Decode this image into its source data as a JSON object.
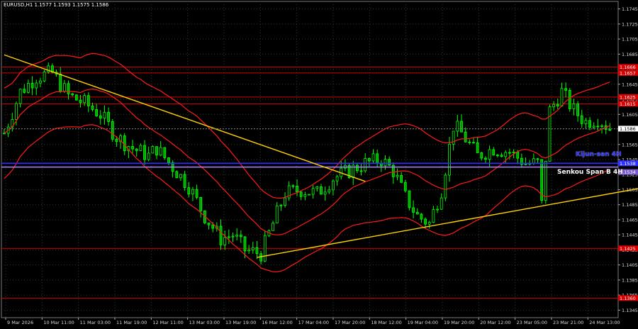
{
  "window": {
    "title": "EURUSD,H1  1.1577 1.1593 1.1575 1.1586"
  },
  "labels": {
    "kijun": "Kijun-sen 4H",
    "senkou": "Senkou Span B 4H"
  },
  "colors": {
    "background": "#000000",
    "grid": "#2e3a2e",
    "bull": "#00ff00",
    "bear": "#00a000",
    "bollinger": "#ff1a1a",
    "trend": "#ffd200",
    "level_red": "#d80000",
    "kijun": "#2f2fff",
    "senkou": "#b088ff"
  },
  "chart_data": {
    "type": "candlestick",
    "title": "EURUSD,H1  1.1577 1.1593 1.1575 1.1586",
    "ylim": [
      1.1335,
      1.1755
    ],
    "y_ticks": [
      "1.1745",
      "1.1725",
      "1.1705",
      "1.1685",
      "1.1665",
      "1.1645",
      "1.1625",
      "1.1605",
      "1.1585",
      "1.1565",
      "1.1545",
      "1.1525",
      "1.1505",
      "1.1485",
      "1.1465",
      "1.1445",
      "1.1425",
      "1.1405",
      "1.1385",
      "1.1365",
      "1.1345"
    ],
    "x_labels": [
      "9 Mar 2026",
      "10 Mar 11:00",
      "11 Mar 03:00",
      "11 Mar 19:00",
      "12 Mar 11:00",
      "13 Mar 03:00",
      "13 Mar 19:00",
      "16 Mar 12:00",
      "17 Mar 04:00",
      "17 Mar 20:00",
      "18 Mar 12:00",
      "19 Mar 04:00",
      "19 Mar 20:00",
      "20 Mar 12:00",
      "23 Mar 05:00",
      "23 Mar 21:00",
      "24 Mar 13:00"
    ],
    "current_price": "1.1586",
    "levels": [
      {
        "name": "resistance-1",
        "value": 1.1668,
        "label": "1.1666"
      },
      {
        "name": "resistance-2",
        "value": 1.166,
        "label": "1.1657"
      },
      {
        "name": "resistance-3",
        "value": 1.1628,
        "label": "1.1625"
      },
      {
        "name": "resistance-4",
        "value": 1.1619,
        "label": "1.1615"
      },
      {
        "name": "support-1",
        "value": 1.1427,
        "label": "1.1425"
      },
      {
        "name": "support-2",
        "value": 1.1361,
        "label": "1.1360"
      }
    ],
    "kijun": {
      "value": 1.154,
      "label": "1.1538"
    },
    "senkou": {
      "value": 1.1535,
      "label": "1.1534"
    },
    "trendlines": [
      {
        "name": "downtrend-line",
        "x1": 0,
        "y1": 1.1684,
        "x2": 90,
        "y2": 1.1516
      },
      {
        "name": "uptrend-line",
        "x1": 63,
        "y1": 1.1415,
        "x2": 166,
        "y2": 1.1514
      }
    ],
    "path": [
      [
        0,
        1.158
      ],
      [
        4,
        1.1635
      ],
      [
        8,
        1.1655
      ],
      [
        12,
        1.166
      ],
      [
        16,
        1.163
      ],
      [
        20,
        1.162
      ],
      [
        24,
        1.1605
      ],
      [
        28,
        1.1575
      ],
      [
        32,
        1.156
      ],
      [
        36,
        1.155
      ],
      [
        38,
        1.156
      ],
      [
        42,
        1.1535
      ],
      [
        46,
        1.151
      ],
      [
        50,
        1.147
      ],
      [
        54,
        1.144
      ],
      [
        57,
        1.1445
      ],
      [
        60,
        1.1425
      ],
      [
        64,
        1.142
      ],
      [
        67,
        1.146
      ],
      [
        70,
        1.15
      ],
      [
        74,
        1.1505
      ],
      [
        78,
        1.15
      ],
      [
        82,
        1.152
      ],
      [
        86,
        1.153
      ],
      [
        90,
        1.154
      ],
      [
        94,
        1.1545
      ],
      [
        97,
        1.153
      ],
      [
        100,
        1.1495
      ],
      [
        103,
        1.147
      ],
      [
        106,
        1.146
      ],
      [
        109,
        1.1505
      ],
      [
        112,
        1.159
      ],
      [
        114,
        1.158
      ],
      [
        118,
        1.155
      ],
      [
        122,
        1.156
      ],
      [
        126,
        1.1555
      ],
      [
        130,
        1.154
      ],
      [
        133,
        1.154
      ],
      [
        134,
        1.1485
      ],
      [
        136,
        1.161
      ],
      [
        139,
        1.1635
      ],
      [
        142,
        1.161
      ],
      [
        145,
        1.1595
      ],
      [
        148,
        1.16
      ],
      [
        151,
        1.1586
      ]
    ],
    "candle_count": 152,
    "bb_width": [
      0.006,
      0.005,
      0.0046,
      0.005,
      0.0058,
      0.0062,
      0.006,
      0.005,
      0.0045,
      0.0048,
      0.006,
      0.0064,
      0.006,
      0.005,
      0.0048,
      0.006,
      0.0058
    ]
  }
}
